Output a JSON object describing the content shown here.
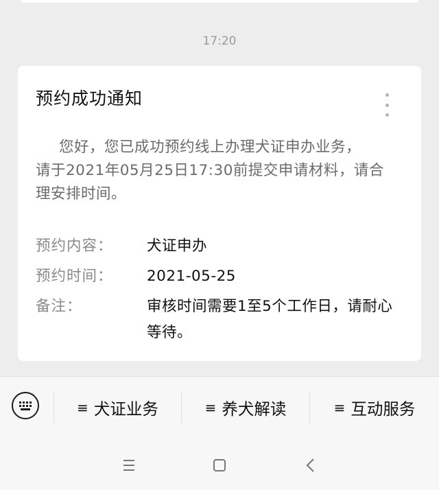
{
  "timestamp": "17:20",
  "card": {
    "title": "预约成功通知",
    "body_lines": [
      "您好，您已成功预约线上办理犬证申办业务，",
      "请于2021年05月25日17:30前提交申请材料，请合",
      "理安排时间。"
    ],
    "details": [
      {
        "label": "预约内容：",
        "value": "犬证申办"
      },
      {
        "label": "预约时间：",
        "value": "2021-05-25"
      },
      {
        "label": "备注：",
        "value": "审核时间需要1至5个工作日，请耐心等待。"
      }
    ]
  },
  "menu": {
    "items": [
      {
        "icon": "≡",
        "label": "犬证业务"
      },
      {
        "icon": "≡",
        "label": "养犬解读"
      },
      {
        "icon": "≡",
        "label": "互动服务"
      }
    ]
  },
  "icons": {
    "keyboard": "keyboard-icon",
    "more": "more-vertical-icon",
    "nav_menu": "menu-icon",
    "nav_home": "home-square-icon",
    "nav_back": "back-chevron-icon"
  }
}
